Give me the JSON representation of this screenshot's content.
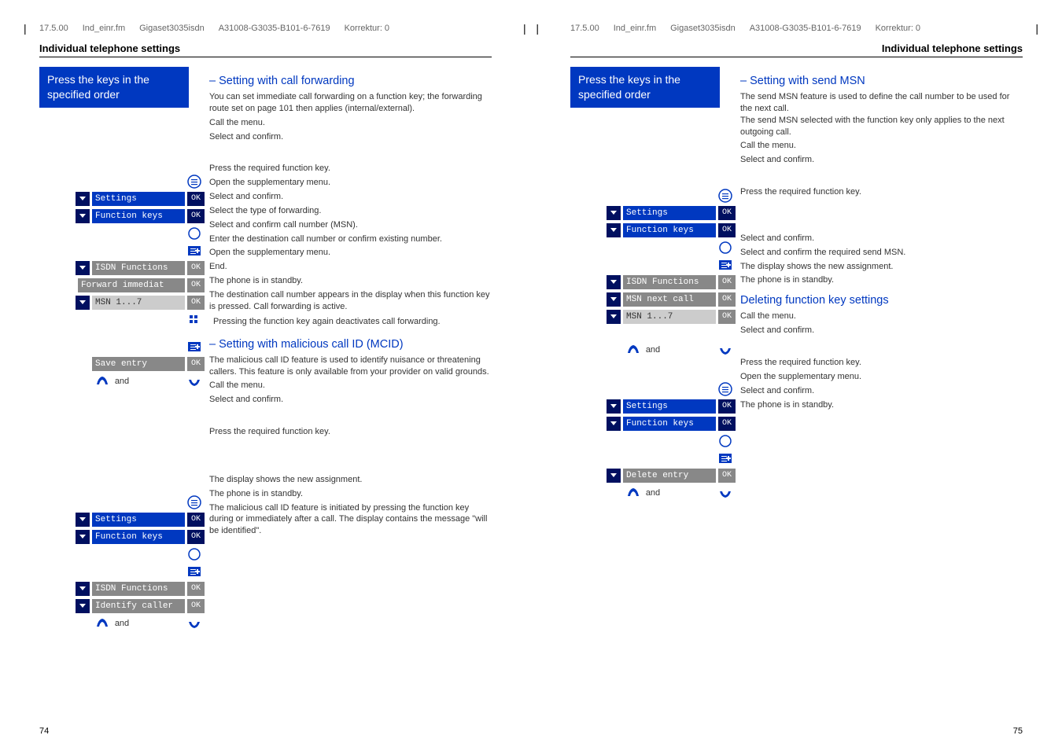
{
  "meta": {
    "date": "17.5.00",
    "file": "Ind_einr.fm",
    "product": "Gigaset3035isdn",
    "partno": "A31008-G3035-B101-6-7619",
    "korrektur": "Korrektur: 0"
  },
  "page_title": "Individual telephone settings",
  "blue_box_line1": "Press the keys in the",
  "blue_box_line2": "specified order",
  "left_page": {
    "number": "74",
    "sections": {
      "forwarding": {
        "heading": "– Setting with call forwarding",
        "intro": "You can set immediate call forwarding on a function key; the forwarding route set on page 101 then applies (internal/external).",
        "step_call_menu": "Call the menu.",
        "step_select_confirm": "Select and confirm.",
        "step_press_function_key": "Press the required function key.",
        "step_open_supp_menu": "Open the supplementary menu.",
        "step_select_type_forward": "Select the type of forwarding.",
        "step_select_confirm_msn": "Select and confirm call number (MSN).",
        "step_enter_destination": "Enter the destination call number or confirm existing number.",
        "step_end": "End.",
        "step_standby": "The phone is in standby.",
        "note_destination": "The destination call number appears in the display when this function key is pressed. Call forwarding is active.",
        "tip_deactivate": "Pressing the function key again deactivates call forwarding.",
        "labels": {
          "settings": "Settings",
          "function_keys": "Function keys",
          "isdn_functions": "ISDN Functions",
          "forward_immediat": "Forward immediat",
          "msn_1_7": "MSN 1...7",
          "save_entry": "Save entry",
          "identify_caller": "Identify caller",
          "ok": "OK"
        }
      },
      "mcid": {
        "heading": "– Setting with malicious call ID (MCID)",
        "intro": "The malicious call ID feature is used to identify nuisance or threatening callers. This feature is only available from your provider on valid grounds.",
        "step_call_menu": "Call the menu.",
        "step_select_confirm": "Select and confirm.",
        "step_press_function_key": "Press the required function key.",
        "step_assignment": "The display shows the new assignment.",
        "step_standby": "The phone is in standby.",
        "note_initiated": "The malicious call ID feature is initiated by pressing the function key during or immediately after a call. The display contains the message \"will be identified\"."
      }
    }
  },
  "right_page": {
    "number": "75",
    "sections": {
      "send_msn": {
        "heading": "– Setting with send MSN",
        "intro": "The send MSN feature is used to define the call number to be used for the next call.\nThe send MSN selected with the function key only applies to the next outgoing call.",
        "step_call_menu": "Call the menu.",
        "step_select_confirm": "Select and confirm.",
        "step_press_function_key": "Press the required function key.",
        "step_select_confirm2": "Select and confirm.",
        "step_select_send_msn": "Select and confirm the required send MSN.",
        "step_assignment": "The display shows the new assignment.",
        "step_standby": "The phone is in standby.",
        "labels": {
          "msn_next_call": "MSN next call",
          "delete_entry": "Delete entry"
        }
      },
      "delete": {
        "heading": "Deleting function key settings",
        "step_call_menu": "Call the menu.",
        "step_select_confirm": "Select and confirm.",
        "step_press_function_key": "Press the required function key.",
        "step_open_supp_menu": "Open the supplementary menu.",
        "step_select_confirm2": "Select and confirm.",
        "step_standby": "The phone is in standby."
      }
    }
  },
  "and": "and"
}
